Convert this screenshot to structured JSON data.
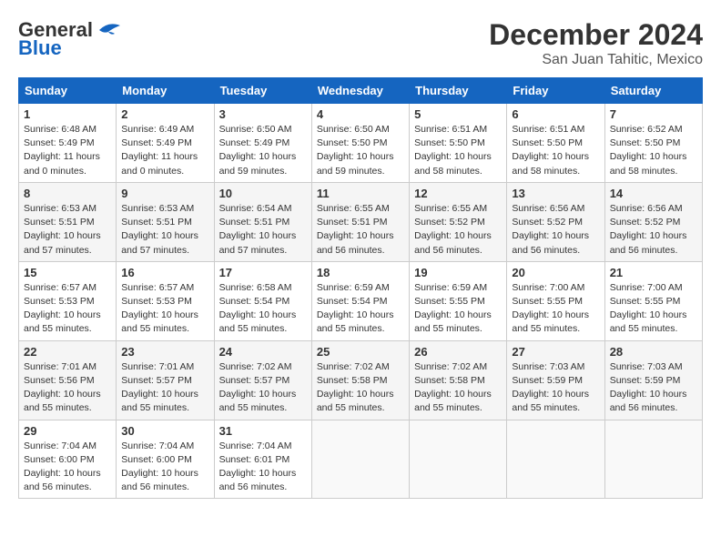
{
  "header": {
    "logo_general": "General",
    "logo_blue": "Blue",
    "month": "December 2024",
    "location": "San Juan Tahitic, Mexico"
  },
  "days_of_week": [
    "Sunday",
    "Monday",
    "Tuesday",
    "Wednesday",
    "Thursday",
    "Friday",
    "Saturday"
  ],
  "weeks": [
    [
      {
        "day": "1",
        "sunrise": "6:48 AM",
        "sunset": "5:49 PM",
        "daylight": "11 hours and 0 minutes."
      },
      {
        "day": "2",
        "sunrise": "6:49 AM",
        "sunset": "5:49 PM",
        "daylight": "11 hours and 0 minutes."
      },
      {
        "day": "3",
        "sunrise": "6:50 AM",
        "sunset": "5:49 PM",
        "daylight": "10 hours and 59 minutes."
      },
      {
        "day": "4",
        "sunrise": "6:50 AM",
        "sunset": "5:50 PM",
        "daylight": "10 hours and 59 minutes."
      },
      {
        "day": "5",
        "sunrise": "6:51 AM",
        "sunset": "5:50 PM",
        "daylight": "10 hours and 58 minutes."
      },
      {
        "day": "6",
        "sunrise": "6:51 AM",
        "sunset": "5:50 PM",
        "daylight": "10 hours and 58 minutes."
      },
      {
        "day": "7",
        "sunrise": "6:52 AM",
        "sunset": "5:50 PM",
        "daylight": "10 hours and 58 minutes."
      }
    ],
    [
      {
        "day": "8",
        "sunrise": "6:53 AM",
        "sunset": "5:51 PM",
        "daylight": "10 hours and 57 minutes."
      },
      {
        "day": "9",
        "sunrise": "6:53 AM",
        "sunset": "5:51 PM",
        "daylight": "10 hours and 57 minutes."
      },
      {
        "day": "10",
        "sunrise": "6:54 AM",
        "sunset": "5:51 PM",
        "daylight": "10 hours and 57 minutes."
      },
      {
        "day": "11",
        "sunrise": "6:55 AM",
        "sunset": "5:51 PM",
        "daylight": "10 hours and 56 minutes."
      },
      {
        "day": "12",
        "sunrise": "6:55 AM",
        "sunset": "5:52 PM",
        "daylight": "10 hours and 56 minutes."
      },
      {
        "day": "13",
        "sunrise": "6:56 AM",
        "sunset": "5:52 PM",
        "daylight": "10 hours and 56 minutes."
      },
      {
        "day": "14",
        "sunrise": "6:56 AM",
        "sunset": "5:52 PM",
        "daylight": "10 hours and 56 minutes."
      }
    ],
    [
      {
        "day": "15",
        "sunrise": "6:57 AM",
        "sunset": "5:53 PM",
        "daylight": "10 hours and 55 minutes."
      },
      {
        "day": "16",
        "sunrise": "6:57 AM",
        "sunset": "5:53 PM",
        "daylight": "10 hours and 55 minutes."
      },
      {
        "day": "17",
        "sunrise": "6:58 AM",
        "sunset": "5:54 PM",
        "daylight": "10 hours and 55 minutes."
      },
      {
        "day": "18",
        "sunrise": "6:59 AM",
        "sunset": "5:54 PM",
        "daylight": "10 hours and 55 minutes."
      },
      {
        "day": "19",
        "sunrise": "6:59 AM",
        "sunset": "5:55 PM",
        "daylight": "10 hours and 55 minutes."
      },
      {
        "day": "20",
        "sunrise": "7:00 AM",
        "sunset": "5:55 PM",
        "daylight": "10 hours and 55 minutes."
      },
      {
        "day": "21",
        "sunrise": "7:00 AM",
        "sunset": "5:55 PM",
        "daylight": "10 hours and 55 minutes."
      }
    ],
    [
      {
        "day": "22",
        "sunrise": "7:01 AM",
        "sunset": "5:56 PM",
        "daylight": "10 hours and 55 minutes."
      },
      {
        "day": "23",
        "sunrise": "7:01 AM",
        "sunset": "5:57 PM",
        "daylight": "10 hours and 55 minutes."
      },
      {
        "day": "24",
        "sunrise": "7:02 AM",
        "sunset": "5:57 PM",
        "daylight": "10 hours and 55 minutes."
      },
      {
        "day": "25",
        "sunrise": "7:02 AM",
        "sunset": "5:58 PM",
        "daylight": "10 hours and 55 minutes."
      },
      {
        "day": "26",
        "sunrise": "7:02 AM",
        "sunset": "5:58 PM",
        "daylight": "10 hours and 55 minutes."
      },
      {
        "day": "27",
        "sunrise": "7:03 AM",
        "sunset": "5:59 PM",
        "daylight": "10 hours and 55 minutes."
      },
      {
        "day": "28",
        "sunrise": "7:03 AM",
        "sunset": "5:59 PM",
        "daylight": "10 hours and 56 minutes."
      }
    ],
    [
      {
        "day": "29",
        "sunrise": "7:04 AM",
        "sunset": "6:00 PM",
        "daylight": "10 hours and 56 minutes."
      },
      {
        "day": "30",
        "sunrise": "7:04 AM",
        "sunset": "6:00 PM",
        "daylight": "10 hours and 56 minutes."
      },
      {
        "day": "31",
        "sunrise": "7:04 AM",
        "sunset": "6:01 PM",
        "daylight": "10 hours and 56 minutes."
      },
      null,
      null,
      null,
      null
    ]
  ]
}
